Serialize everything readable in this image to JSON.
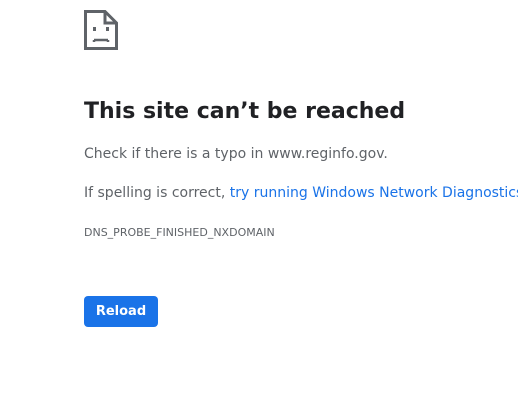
{
  "error_page": {
    "icon": "sad-page-icon",
    "title": "This site can’t be reached",
    "line1": "Check if there is a typo in www.reginfo.gov.",
    "line2_prefix": "If spelling is correct, ",
    "line2_link": "try running Windows Network Diagnostics",
    "line2_suffix": ".",
    "error_code": "DNS_PROBE_FINISHED_NXDOMAIN",
    "reload_label": "Reload"
  },
  "colors": {
    "title": "#202124",
    "body_text": "#5f6368",
    "link": "#1a73e8",
    "button_bg": "#1a73e8",
    "button_text": "#ffffff"
  }
}
